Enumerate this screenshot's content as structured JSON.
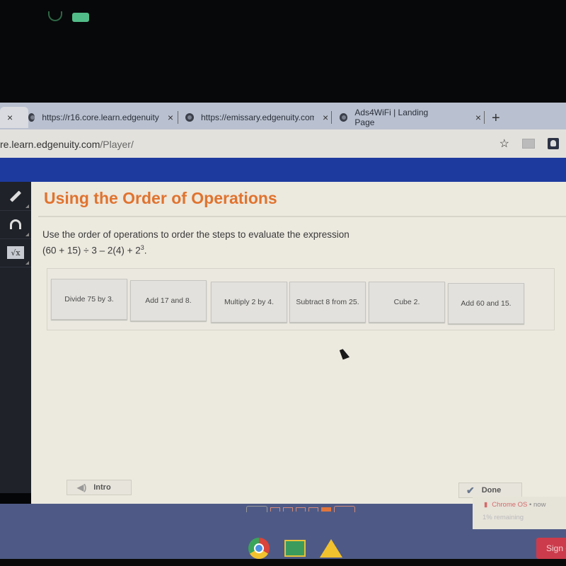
{
  "browser": {
    "tabs": [
      {
        "label": "",
        "close": "×",
        "active": true
      },
      {
        "label": "https://r16.core.learn.edgenuity",
        "close": "×"
      },
      {
        "label": "https://emissary.edgenuity.com",
        "close": "×"
      },
      {
        "label": "Ads4WiFi | Landing Page",
        "close": "×"
      }
    ],
    "new_tab": "+",
    "url_host": "re.learn.edgenuity.com",
    "url_path": "/Player/",
    "star": "☆"
  },
  "sidebar": {
    "tools": [
      {
        "name": "pencil"
      },
      {
        "name": "headphones"
      },
      {
        "name": "calculator",
        "glyph": "√x"
      }
    ]
  },
  "lesson": {
    "title": "Using the Order of Operations",
    "prompt_line1": "Use the order of operations to order the steps to evaluate the expression",
    "expression_base": "(60 + 15) ÷ 3 – 2(4) + 2",
    "expression_exp": "3",
    "expression_end": ".",
    "tiles": [
      "Divide 75 by 3.",
      "Add 17 and 8.",
      "Multiply 2 by 4.",
      "Subtract 8 from 25.",
      "Cube 2.",
      "Add 60 and 15."
    ]
  },
  "footer": {
    "intro_label": "Intro",
    "done_label": "Done",
    "pages": 5,
    "active_page": 5
  },
  "notification": {
    "source": "Chrome OS",
    "time": "now",
    "separator": "•",
    "message": "1% remaining"
  },
  "taskbar": {
    "apps": [
      "Chrome",
      "Google Classroom",
      "Google Drive"
    ],
    "signin_label": "Sign out"
  }
}
